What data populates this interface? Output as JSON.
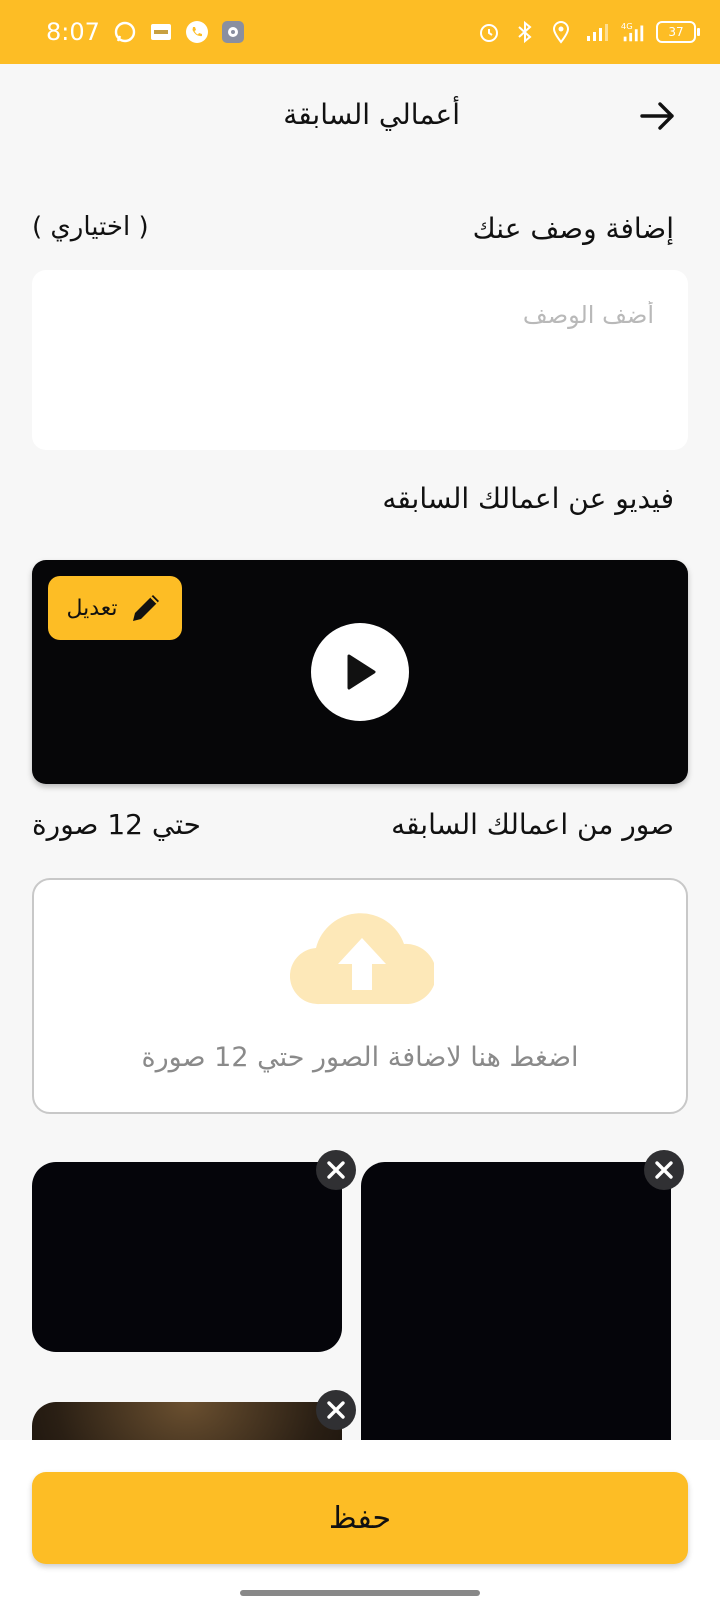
{
  "status_bar": {
    "time": "8:07",
    "battery": "37",
    "network": "4G",
    "icons_left": [
      "whatsapp-icon",
      "gallery-icon",
      "phone-icon",
      "settings-icon"
    ],
    "icons_right": [
      "alarm-icon",
      "bluetooth-icon",
      "location-icon",
      "signal-icon",
      "signal-4g-icon",
      "battery-icon"
    ]
  },
  "header": {
    "title": "أعمالي السابقة",
    "back_icon": "arrow-right-icon"
  },
  "description": {
    "label": "إضافة وصف عنك",
    "optional_label": "( اختياري )",
    "placeholder": "أضف الوصف",
    "value": ""
  },
  "video": {
    "label": "فيديو عن اعمالك السابقه",
    "edit_label": "تعديل"
  },
  "photos": {
    "label": "صور من اعمالك السابقه",
    "limit_label": "حتي 12 صورة",
    "upload_text": "اضغط هنا لاضافة الصور حتي 12 صورة",
    "items_count": 3
  },
  "footer": {
    "save_label": "حفظ"
  },
  "colors": {
    "accent": "#fdbd25",
    "background": "#f7f7f7",
    "upload_icon": "#fde8b8"
  }
}
